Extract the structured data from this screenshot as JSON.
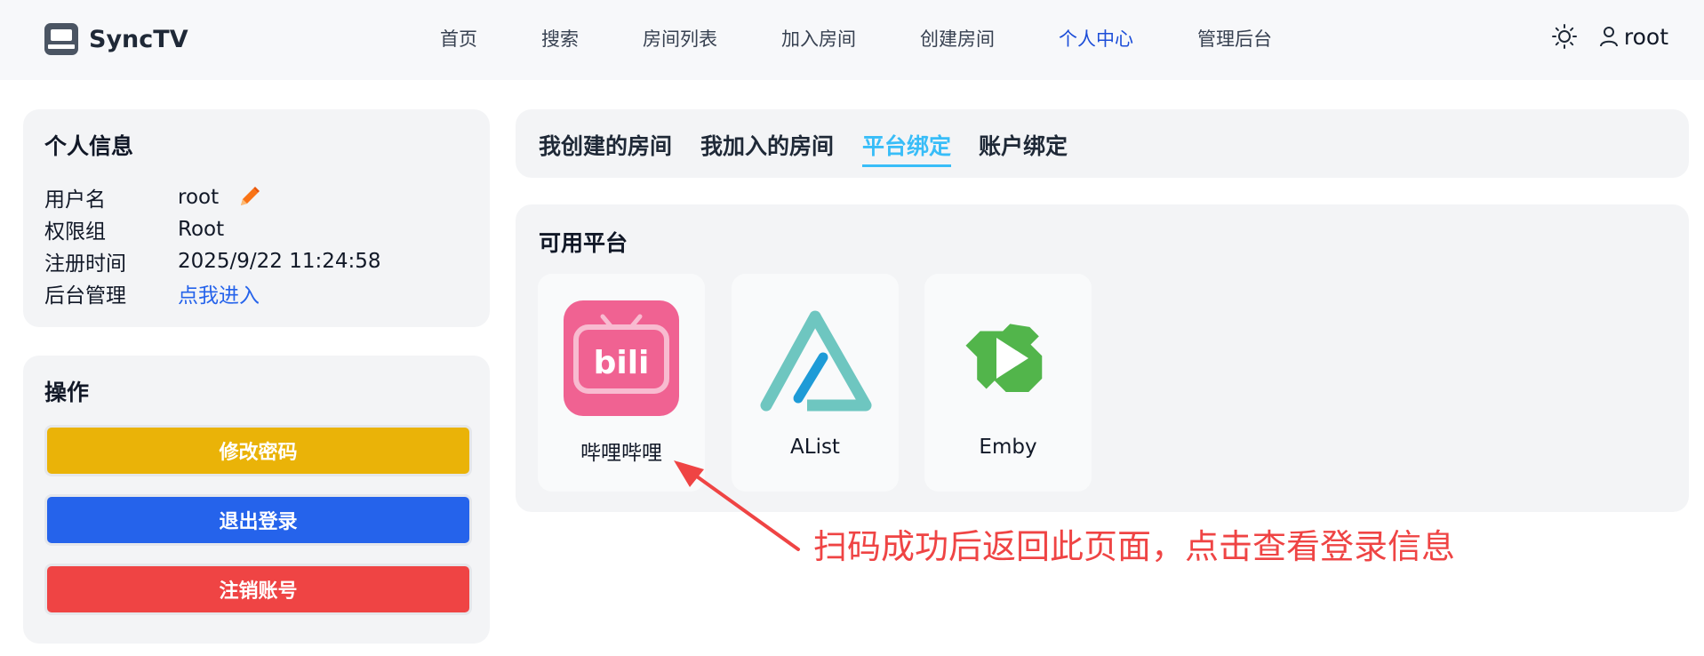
{
  "header": {
    "brand": "SyncTV",
    "nav": [
      "首页",
      "搜索",
      "房间列表",
      "加入房间",
      "创建房间",
      "个人中心",
      "管理后台"
    ],
    "active_nav": "个人中心",
    "user": "root",
    "icons": {
      "logo": "synctv-logo-icon",
      "theme": "sun-icon",
      "user": "user-icon"
    }
  },
  "profile": {
    "title": "个人信息",
    "rows": [
      {
        "key": "用户名",
        "value": "root"
      },
      {
        "key": "权限组",
        "value": "Root"
      },
      {
        "key": "注册时间",
        "value": "2025/9/22 11:24:58"
      },
      {
        "key": "后台管理",
        "value": "点我进入"
      }
    ]
  },
  "actions": {
    "title": "操作",
    "buttons": [
      {
        "label": "修改密码",
        "color": "#eab308"
      },
      {
        "label": "退出登录",
        "color": "#2563eb"
      },
      {
        "label": "注销账号",
        "color": "#ef4444"
      }
    ]
  },
  "tabs": {
    "items": [
      "我创建的房间",
      "我加入的房间",
      "平台绑定",
      "账户绑定"
    ],
    "active": "平台绑定",
    "accent": "#38bdf8"
  },
  "platforms": {
    "title": "可用平台",
    "items": [
      {
        "label": "哔哩哔哩",
        "icon": "bilibili-icon",
        "color": "#f06292"
      },
      {
        "label": "AList",
        "icon": "alist-icon",
        "color": "#6ec6c0"
      },
      {
        "label": "Emby",
        "icon": "emby-icon",
        "color": "#52b54b"
      }
    ]
  },
  "annotation": {
    "text": "扫码成功后返回此页面，点击查看登录信息",
    "color": "#ef4444"
  }
}
